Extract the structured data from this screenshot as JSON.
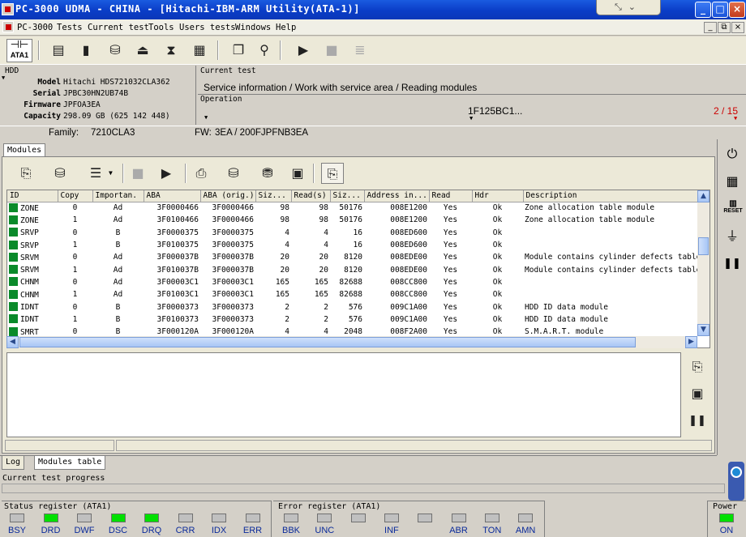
{
  "window": {
    "title": "PC-3000 UDMA - CHINA - [Hitachi-IBM-ARM Utility(ATA-1)]",
    "controls": [
      "_",
      "□",
      "×"
    ],
    "strip_icons": [
      "⤡",
      "⌄"
    ]
  },
  "menu": {
    "items": [
      "PC-3000",
      "Tests",
      "Current test",
      "Tools",
      "Users tests",
      "Windows",
      "Help"
    ],
    "mdi_controls": [
      "_",
      "⧉",
      "×"
    ]
  },
  "toolbar": {
    "ata_label": "ATA1"
  },
  "hdd": {
    "header": "HDD",
    "model_label": "Model",
    "model": "Hitachi HDS721032CLA362",
    "serial_label": "Serial",
    "serial": "JPBC30HN2UB74B",
    "firmware_label": "Firmware",
    "firmware": "JPFOA3EA",
    "capacity_label": "Capacity",
    "capacity": "298.09 GB (625 142 448)",
    "family_label": "Family:",
    "family": "7210CLA3"
  },
  "current_test": {
    "label": "Current test",
    "value": "Service information / Work with service area / Reading modules",
    "operation_label": "Operation",
    "operation_value": "1F125BC1...",
    "progress": "2 / 15",
    "fw_label": "FW:",
    "fw_value": "3EA / 200FJPFNB3EA"
  },
  "modules_tab": "Modules",
  "table": {
    "columns": [
      "ID",
      "Copy",
      "Importan.",
      "ABA",
      "ABA (orig.)",
      "Siz...",
      "Read(s)",
      "Siz...",
      "Address in...",
      "Read",
      "Hdr",
      "Description"
    ],
    "rows": [
      [
        "ZONE",
        "0",
        "Ad",
        "3F0000466",
        "3F0000466",
        "98",
        "98",
        "50176",
        "008E1200",
        "Yes",
        "Ok",
        "Zone allocation table module"
      ],
      [
        "ZONE",
        "1",
        "Ad",
        "3F0100466",
        "3F0000466",
        "98",
        "98",
        "50176",
        "008E1200",
        "Yes",
        "Ok",
        "Zone allocation table module"
      ],
      [
        "SRVP",
        "0",
        "B",
        "3F0000375",
        "3F0000375",
        "4",
        "4",
        "16",
        "008ED600",
        "Yes",
        "Ok",
        ""
      ],
      [
        "SRVP",
        "1",
        "B",
        "3F0100375",
        "3F0000375",
        "4",
        "4",
        "16",
        "008ED600",
        "Yes",
        "Ok",
        ""
      ],
      [
        "SRVM",
        "0",
        "Ad",
        "3F000037B",
        "3F000037B",
        "20",
        "20",
        "8120",
        "008EDE00",
        "Yes",
        "Ok",
        "Module contains cylinder defects table"
      ],
      [
        "SRVM",
        "1",
        "Ad",
        "3F010037B",
        "3F000037B",
        "20",
        "20",
        "8120",
        "008EDE00",
        "Yes",
        "Ok",
        "Module contains cylinder defects table"
      ],
      [
        "CHNM",
        "0",
        "Ad",
        "3F00003C1",
        "3F00003C1",
        "165",
        "165",
        "82688",
        "008CC800",
        "Yes",
        "Ok",
        ""
      ],
      [
        "CHNM",
        "1",
        "Ad",
        "3F01003C1",
        "3F00003C1",
        "165",
        "165",
        "82688",
        "008CC800",
        "Yes",
        "Ok",
        ""
      ],
      [
        "IDNT",
        "0",
        "B",
        "3F0000373",
        "3F0000373",
        "2",
        "2",
        "576",
        "009C1A00",
        "Yes",
        "Ok",
        "HDD ID data module"
      ],
      [
        "IDNT",
        "1",
        "B",
        "3F0100373",
        "3F0000373",
        "2",
        "2",
        "576",
        "009C1A00",
        "Yes",
        "Ok",
        "HDD ID data module"
      ],
      [
        "SMRT",
        "0",
        "B",
        "3F000120A",
        "3F000120A",
        "4",
        "4",
        "2048",
        "008F2A00",
        "Yes",
        "Ok",
        "S.M.A.R.T. module"
      ]
    ]
  },
  "bottom_tabs": [
    "Log",
    "Modules table"
  ],
  "progress_label": "Current test progress",
  "status_register": {
    "label": "Status register (ATA1)",
    "leds": [
      {
        "name": "BSY",
        "on": false
      },
      {
        "name": "DRD",
        "on": true
      },
      {
        "name": "DWF",
        "on": false
      },
      {
        "name": "DSC",
        "on": true
      },
      {
        "name": "DRQ",
        "on": true
      },
      {
        "name": "CRR",
        "on": false
      },
      {
        "name": "IDX",
        "on": false
      },
      {
        "name": "ERR",
        "on": false
      }
    ]
  },
  "error_register": {
    "label": "Error register (ATA1)",
    "leds": [
      {
        "name": "BBK",
        "on": false
      },
      {
        "name": "UNC",
        "on": false
      },
      {
        "name": "",
        "on": false
      },
      {
        "name": "INF",
        "on": false
      },
      {
        "name": "",
        "on": false
      },
      {
        "name": "ABR",
        "on": false
      },
      {
        "name": "TON",
        "on": false
      },
      {
        "name": "AMN",
        "on": false
      }
    ]
  },
  "power": {
    "label": "Power",
    "state": "ON",
    "on": true
  },
  "side_labels": {
    "reset": "RESET"
  },
  "colors": {
    "title_bar": "#0a3dc7",
    "led_on": "#00e000",
    "progress_red": "#cc0000",
    "module_ok": "#0a8a2a"
  }
}
